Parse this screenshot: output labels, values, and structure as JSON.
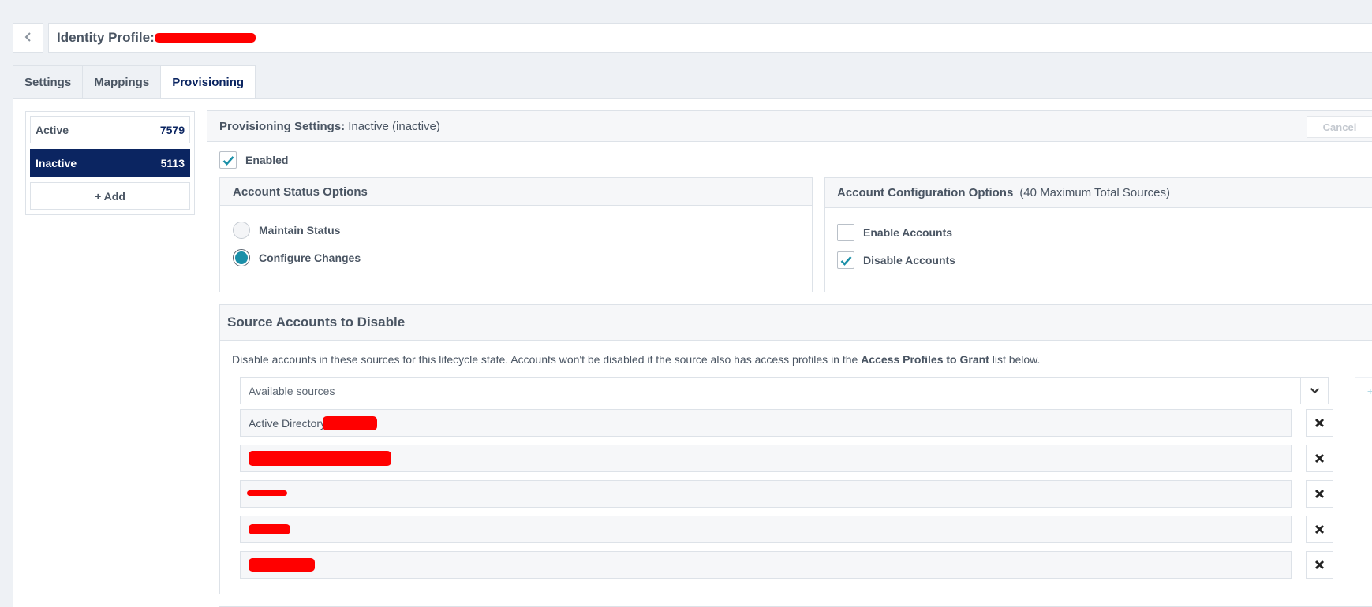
{
  "header": {
    "title_label": "Identity Profile:"
  },
  "tabs": [
    {
      "label": "Settings"
    },
    {
      "label": "Mappings"
    },
    {
      "label": "Provisioning"
    }
  ],
  "states": [
    {
      "label": "Active",
      "count": "7579"
    },
    {
      "label": "Inactive",
      "count": "5113"
    }
  ],
  "add_label": "+ Add",
  "panel": {
    "title_label": "Provisioning Settings:",
    "title_value": "Inactive (inactive)",
    "cancel_label": "Cancel",
    "enabled_label": "Enabled",
    "enabled_checked": true
  },
  "status_options": {
    "title": "Account Status Options",
    "options": [
      {
        "label": "Maintain Status",
        "selected": false
      },
      {
        "label": "Configure Changes",
        "selected": true
      }
    ]
  },
  "config_options": {
    "title": "Account Configuration Options",
    "subtitle": "(40 Maximum Total Sources)",
    "options": [
      {
        "label": "Enable Accounts",
        "checked": false
      },
      {
        "label": "Disable Accounts",
        "checked": true
      }
    ]
  },
  "source_section": {
    "title": "Source Accounts to Disable",
    "desc_prefix": "Disable accounts in these sources for this lifecycle state. Accounts won't be disabled if the source also has access profiles in the ",
    "desc_bold": "Access Profiles to Grant",
    "desc_suffix": " list below.",
    "placeholder": "Available sources",
    "add_symbol": "+",
    "sources": [
      {
        "label": "Active Directory"
      },
      {
        "label": ""
      },
      {
        "label": ""
      },
      {
        "label": ""
      },
      {
        "label": ""
      }
    ]
  },
  "colors": {
    "accent": "#1a8fa8",
    "selected_bg": "#0b2561",
    "redaction": "#ff0000"
  },
  "icons": [
    "chevron-left-icon",
    "check-icon",
    "chevron-down-icon",
    "close-icon"
  ]
}
